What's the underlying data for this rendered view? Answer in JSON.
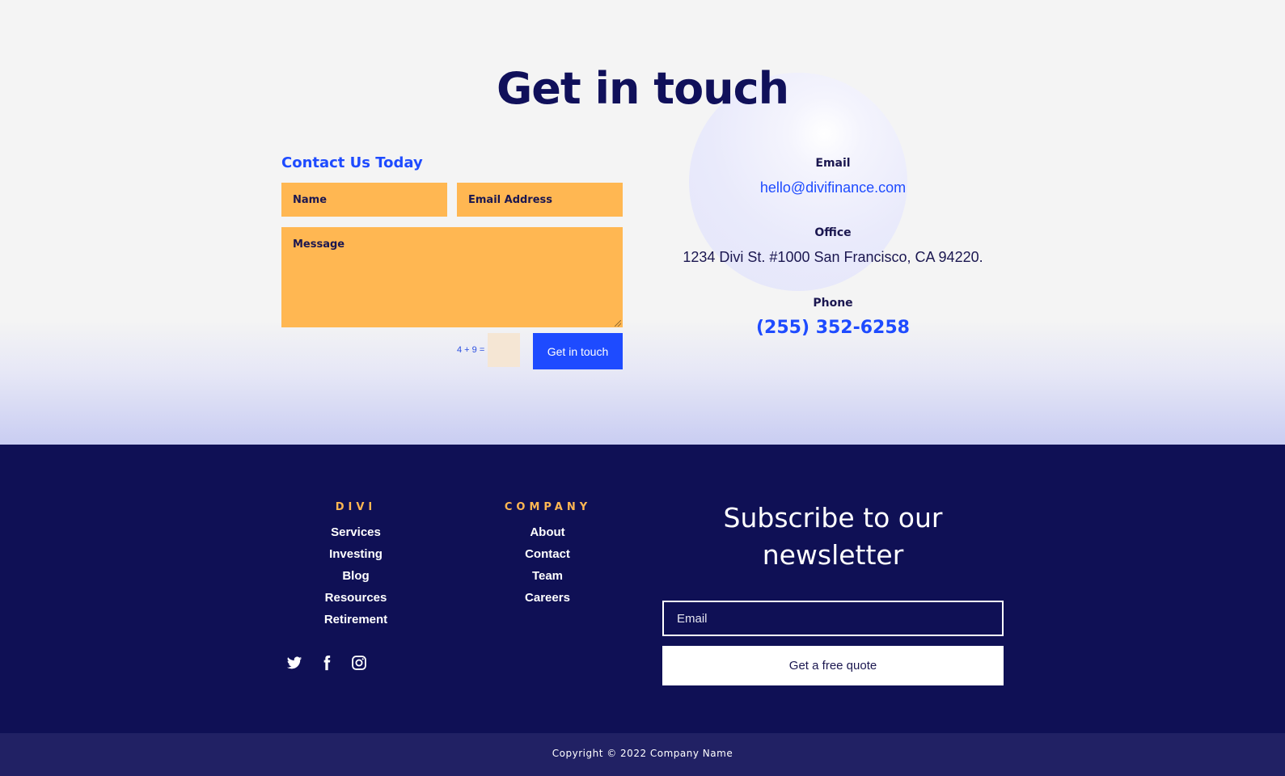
{
  "contact": {
    "title": "Get in touch",
    "form": {
      "heading": "Contact Us Today",
      "name_placeholder": "Name",
      "email_placeholder": "Email Address",
      "message_placeholder": "Message",
      "captcha": "4 + 9 =",
      "submit_label": "Get in touch"
    },
    "info": {
      "email_label": "Email",
      "email_value": "hello@divifinance.com",
      "office_label": "Office",
      "office_value": "1234 Divi St. #1000 San Francisco, CA 94220.",
      "phone_label": "Phone",
      "phone_value": "(255) 352-6258"
    }
  },
  "footer": {
    "divi": {
      "title": "DIVI",
      "links": [
        "Services",
        "Investing",
        "Blog",
        "Resources",
        "Retirement"
      ]
    },
    "company": {
      "title": "COMPANY",
      "links": [
        "About",
        "Contact",
        "Team",
        "Careers"
      ]
    },
    "social": [
      "twitter-icon",
      "facebook-icon",
      "instagram-icon"
    ],
    "newsletter": {
      "title": "Subscribe to our newsletter",
      "email_placeholder": "Email",
      "button_label": "Get a free quote"
    },
    "copyright": "Copyright © 2022 Company Name"
  },
  "colors": {
    "accent": "#1e4bff",
    "navy": "#0f1055",
    "orange": "#ffb752"
  }
}
